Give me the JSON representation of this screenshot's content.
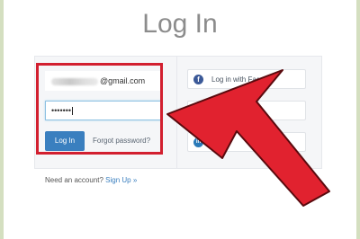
{
  "header": {
    "title": "Log In"
  },
  "login_form": {
    "email_suffix": "@gmail.com",
    "password_value": "•••••••",
    "login_button": "Log In",
    "forgot_link": "Forgot password?"
  },
  "social": {
    "facebook_label": "Log in with Face",
    "linkedin_icon": "in"
  },
  "footer": {
    "need_account": "Need an account?",
    "signup_link": "Sign Up »"
  },
  "colors": {
    "highlight": "#d21f2f",
    "primary": "#3a7fbf",
    "arrow": "#e1222f"
  }
}
